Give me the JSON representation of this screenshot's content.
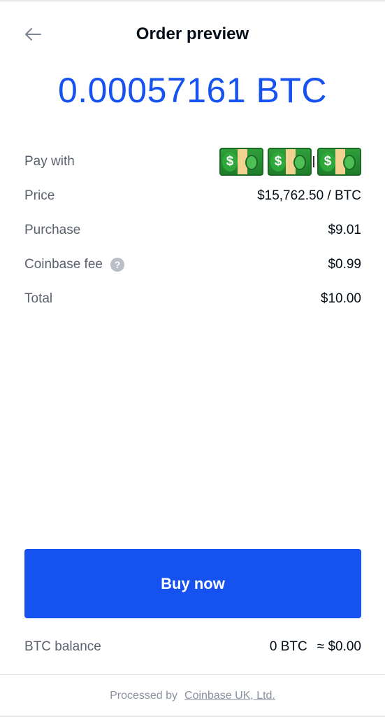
{
  "header": {
    "back_icon": "arrow-left-icon",
    "title": "Order preview"
  },
  "order": {
    "amount": "0.00057161 BTC"
  },
  "details": {
    "pay_with": {
      "label": "Pay with",
      "icons": [
        "money-bill-icon",
        "money-bill-icon",
        "money-bill-icon"
      ]
    },
    "price": {
      "label": "Price",
      "value": "$15,762.50 / BTC"
    },
    "purchase": {
      "label": "Purchase",
      "value": "$9.01"
    },
    "fee": {
      "label": "Coinbase fee",
      "help_icon": "question-mark-icon",
      "help_glyph": "?",
      "value": "$0.99"
    },
    "total": {
      "label": "Total",
      "value": "$10.00"
    }
  },
  "buy_button": {
    "label": "Buy now"
  },
  "balance": {
    "label": "BTC balance",
    "btc": "0 BTC",
    "usd": "≈ $0.00"
  },
  "footer": {
    "text": "Processed by",
    "link": "Coinbase UK, Ltd."
  },
  "colors": {
    "accent": "#1652f0",
    "text_primary": "#050f19",
    "text_secondary": "#5b616e"
  }
}
